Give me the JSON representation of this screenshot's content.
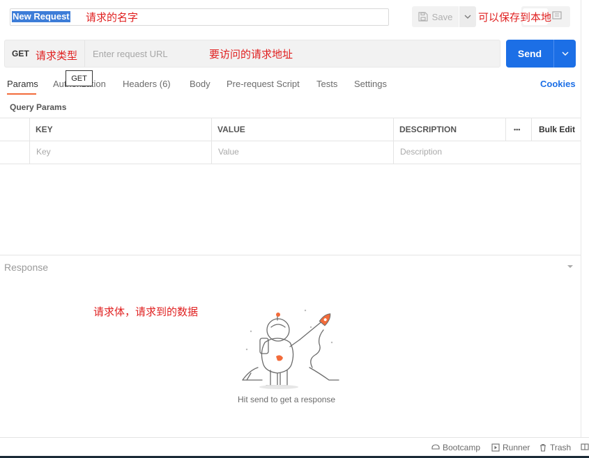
{
  "request": {
    "name": "New Request",
    "method": "GET",
    "url_placeholder": "Enter request URL",
    "tooltip": "GET"
  },
  "toolbar": {
    "save_label": "Save",
    "send_label": "Send"
  },
  "tabs": [
    {
      "label": "Params"
    },
    {
      "label": "Authorization"
    },
    {
      "label": "Headers (6)"
    },
    {
      "label": "Body"
    },
    {
      "label": "Pre-request Script"
    },
    {
      "label": "Tests"
    },
    {
      "label": "Settings"
    }
  ],
  "cookies_label": "Cookies",
  "params": {
    "title": "Query Params",
    "headers": {
      "key": "KEY",
      "value": "VALUE",
      "description": "DESCRIPTION",
      "more": "•••",
      "bulk_edit": "Bulk Edit"
    },
    "placeholders": {
      "key": "Key",
      "value": "Value",
      "description": "Description"
    }
  },
  "response": {
    "title": "Response",
    "empty_text": "Hit send to get a response"
  },
  "footer": {
    "bootcamp": "Bootcamp",
    "runner": "Runner",
    "trash": "Trash"
  },
  "annotations": {
    "name": "请求的名字",
    "save": "可以保存到本地",
    "method": "请求类型",
    "url": "要访问的请求地址",
    "body": "请求体，请求到的数据"
  },
  "colors": {
    "accent": "#1c6fe6",
    "tab_underline": "#f26b3a",
    "annotation": "#e02020"
  }
}
